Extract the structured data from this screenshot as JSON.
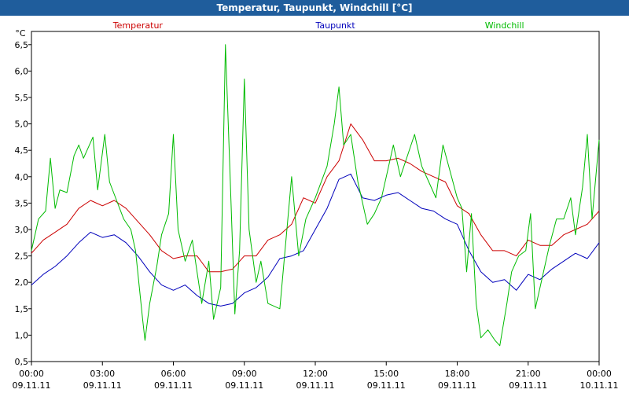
{
  "window": {
    "title": "Temperatur, Taupunkt, Windchill [°C]"
  },
  "chart_data": {
    "type": "line",
    "title": "Temperatur, Taupunkt, Windchill [°C]",
    "ylabel": "°C",
    "xlabel": "",
    "xlim": [
      0,
      24
    ],
    "ylim": [
      0.5,
      6.75
    ],
    "yticks": [
      0.5,
      1.0,
      1.5,
      2.0,
      2.5,
      3.0,
      3.5,
      4.0,
      4.5,
      5.0,
      5.5,
      6.0,
      6.5
    ],
    "ytick_labels": [
      "0,5",
      "1,0",
      "1,5",
      "2,0",
      "2,5",
      "3,0",
      "3,5",
      "4,0",
      "4,5",
      "5,0",
      "5,5",
      "6,0",
      "6,5"
    ],
    "xticks": [
      {
        "x": 0,
        "time": "00:00",
        "date": "09.11.11"
      },
      {
        "x": 3,
        "time": "03:00",
        "date": "09.11.11"
      },
      {
        "x": 6,
        "time": "06:00",
        "date": "09.11.11"
      },
      {
        "x": 9,
        "time": "09:00",
        "date": "09.11.11"
      },
      {
        "x": 12,
        "time": "12:00",
        "date": "09.11.11"
      },
      {
        "x": 15,
        "time": "15:00",
        "date": "09.11.11"
      },
      {
        "x": 18,
        "time": "18:00",
        "date": "09.11.11"
      },
      {
        "x": 21,
        "time": "21:00",
        "date": "09.11.11"
      },
      {
        "x": 24,
        "time": "00:00",
        "date": "10.11.11"
      }
    ],
    "grid": true,
    "legend_position": "top",
    "series": [
      {
        "name": "Temperatur",
        "color": "#cc0000",
        "points": [
          [
            0,
            2.55
          ],
          [
            0.5,
            2.8
          ],
          [
            1,
            2.95
          ],
          [
            1.5,
            3.1
          ],
          [
            2,
            3.4
          ],
          [
            2.5,
            3.55
          ],
          [
            3,
            3.45
          ],
          [
            3.5,
            3.55
          ],
          [
            4,
            3.4
          ],
          [
            4.5,
            3.15
          ],
          [
            5,
            2.9
          ],
          [
            5.5,
            2.6
          ],
          [
            6,
            2.45
          ],
          [
            6.5,
            2.5
          ],
          [
            7,
            2.5
          ],
          [
            7.5,
            2.2
          ],
          [
            8,
            2.2
          ],
          [
            8.5,
            2.25
          ],
          [
            9,
            2.5
          ],
          [
            9.5,
            2.5
          ],
          [
            10,
            2.8
          ],
          [
            10.5,
            2.9
          ],
          [
            11,
            3.1
          ],
          [
            11.5,
            3.6
          ],
          [
            12,
            3.5
          ],
          [
            12.5,
            4.0
          ],
          [
            13,
            4.3
          ],
          [
            13.5,
            5.0
          ],
          [
            14,
            4.7
          ],
          [
            14.5,
            4.3
          ],
          [
            15,
            4.3
          ],
          [
            15.5,
            4.35
          ],
          [
            16,
            4.25
          ],
          [
            16.5,
            4.1
          ],
          [
            17,
            4.0
          ],
          [
            17.5,
            3.9
          ],
          [
            18,
            3.45
          ],
          [
            18.5,
            3.3
          ],
          [
            19,
            2.9
          ],
          [
            19.5,
            2.6
          ],
          [
            20,
            2.6
          ],
          [
            20.5,
            2.5
          ],
          [
            21,
            2.8
          ],
          [
            21.5,
            2.7
          ],
          [
            22,
            2.7
          ],
          [
            22.5,
            2.9
          ],
          [
            23,
            3.0
          ],
          [
            23.5,
            3.1
          ],
          [
            24,
            3.35
          ]
        ]
      },
      {
        "name": "Taupunkt",
        "color": "#0000bb",
        "points": [
          [
            0,
            1.95
          ],
          [
            0.5,
            2.15
          ],
          [
            1,
            2.3
          ],
          [
            1.5,
            2.5
          ],
          [
            2,
            2.75
          ],
          [
            2.5,
            2.95
          ],
          [
            3,
            2.85
          ],
          [
            3.5,
            2.9
          ],
          [
            4,
            2.75
          ],
          [
            4.5,
            2.5
          ],
          [
            5,
            2.2
          ],
          [
            5.5,
            1.95
          ],
          [
            6,
            1.85
          ],
          [
            6.5,
            1.95
          ],
          [
            7,
            1.75
          ],
          [
            7.5,
            1.6
          ],
          [
            8,
            1.55
          ],
          [
            8.5,
            1.6
          ],
          [
            9,
            1.8
          ],
          [
            9.5,
            1.9
          ],
          [
            10,
            2.1
          ],
          [
            10.5,
            2.45
          ],
          [
            11,
            2.5
          ],
          [
            11.5,
            2.6
          ],
          [
            12,
            3.0
          ],
          [
            12.5,
            3.4
          ],
          [
            13,
            3.95
          ],
          [
            13.5,
            4.05
          ],
          [
            14,
            3.6
          ],
          [
            14.5,
            3.55
          ],
          [
            15,
            3.65
          ],
          [
            15.5,
            3.7
          ],
          [
            16,
            3.55
          ],
          [
            16.5,
            3.4
          ],
          [
            17,
            3.35
          ],
          [
            17.5,
            3.2
          ],
          [
            18,
            3.1
          ],
          [
            18.5,
            2.6
          ],
          [
            19,
            2.2
          ],
          [
            19.5,
            2.0
          ],
          [
            20,
            2.05
          ],
          [
            20.5,
            1.85
          ],
          [
            21,
            2.15
          ],
          [
            21.5,
            2.05
          ],
          [
            22,
            2.25
          ],
          [
            22.5,
            2.4
          ],
          [
            23,
            2.55
          ],
          [
            23.5,
            2.45
          ],
          [
            24,
            2.75
          ]
        ]
      },
      {
        "name": "Windchill",
        "color": "#00bb00",
        "points": [
          [
            0,
            2.6
          ],
          [
            0.3,
            3.2
          ],
          [
            0.6,
            3.35
          ],
          [
            0.8,
            4.35
          ],
          [
            1,
            3.4
          ],
          [
            1.2,
            3.75
          ],
          [
            1.5,
            3.7
          ],
          [
            1.8,
            4.4
          ],
          [
            2,
            4.6
          ],
          [
            2.2,
            4.35
          ],
          [
            2.6,
            4.75
          ],
          [
            2.8,
            3.75
          ],
          [
            3.1,
            4.8
          ],
          [
            3.3,
            3.9
          ],
          [
            3.6,
            3.55
          ],
          [
            3.9,
            3.2
          ],
          [
            4.2,
            3.0
          ],
          [
            4.4,
            2.6
          ],
          [
            4.7,
            1.3
          ],
          [
            4.8,
            0.9
          ],
          [
            5.0,
            1.6
          ],
          [
            5.3,
            2.3
          ],
          [
            5.5,
            2.9
          ],
          [
            5.8,
            3.3
          ],
          [
            6.0,
            4.8
          ],
          [
            6.2,
            3.0
          ],
          [
            6.5,
            2.4
          ],
          [
            6.8,
            2.8
          ],
          [
            7.0,
            2.2
          ],
          [
            7.2,
            1.6
          ],
          [
            7.5,
            2.4
          ],
          [
            7.7,
            1.3
          ],
          [
            8.0,
            1.9
          ],
          [
            8.2,
            6.5
          ],
          [
            8.4,
            4.0
          ],
          [
            8.6,
            1.4
          ],
          [
            8.8,
            2.6
          ],
          [
            9.0,
            5.85
          ],
          [
            9.2,
            3.0
          ],
          [
            9.5,
            2.0
          ],
          [
            9.7,
            2.4
          ],
          [
            10,
            1.6
          ],
          [
            10.5,
            1.5
          ],
          [
            10.8,
            3.0
          ],
          [
            11.0,
            4.0
          ],
          [
            11.3,
            2.5
          ],
          [
            11.6,
            3.2
          ],
          [
            12.0,
            3.6
          ],
          [
            12.5,
            4.2
          ],
          [
            12.8,
            5.0
          ],
          [
            13.0,
            5.7
          ],
          [
            13.2,
            4.6
          ],
          [
            13.5,
            4.8
          ],
          [
            13.8,
            3.9
          ],
          [
            14.2,
            3.1
          ],
          [
            14.5,
            3.3
          ],
          [
            14.8,
            3.6
          ],
          [
            15.0,
            4.0
          ],
          [
            15.3,
            4.6
          ],
          [
            15.6,
            4.0
          ],
          [
            15.9,
            4.4
          ],
          [
            16.2,
            4.8
          ],
          [
            16.5,
            4.2
          ],
          [
            16.8,
            3.9
          ],
          [
            17.1,
            3.6
          ],
          [
            17.4,
            4.6
          ],
          [
            17.7,
            4.1
          ],
          [
            18.0,
            3.6
          ],
          [
            18.2,
            3.4
          ],
          [
            18.4,
            2.2
          ],
          [
            18.6,
            3.3
          ],
          [
            18.8,
            1.6
          ],
          [
            19.0,
            0.95
          ],
          [
            19.3,
            1.1
          ],
          [
            19.6,
            0.9
          ],
          [
            19.8,
            0.8
          ],
          [
            20.1,
            1.6
          ],
          [
            20.3,
            2.2
          ],
          [
            20.6,
            2.5
          ],
          [
            20.9,
            2.6
          ],
          [
            21.1,
            3.3
          ],
          [
            21.3,
            1.5
          ],
          [
            21.6,
            2.1
          ],
          [
            21.9,
            2.7
          ],
          [
            22.2,
            3.2
          ],
          [
            22.5,
            3.2
          ],
          [
            22.8,
            3.6
          ],
          [
            23.0,
            2.9
          ],
          [
            23.3,
            3.8
          ],
          [
            23.5,
            4.8
          ],
          [
            23.7,
            3.2
          ],
          [
            24,
            4.7
          ]
        ]
      }
    ]
  }
}
